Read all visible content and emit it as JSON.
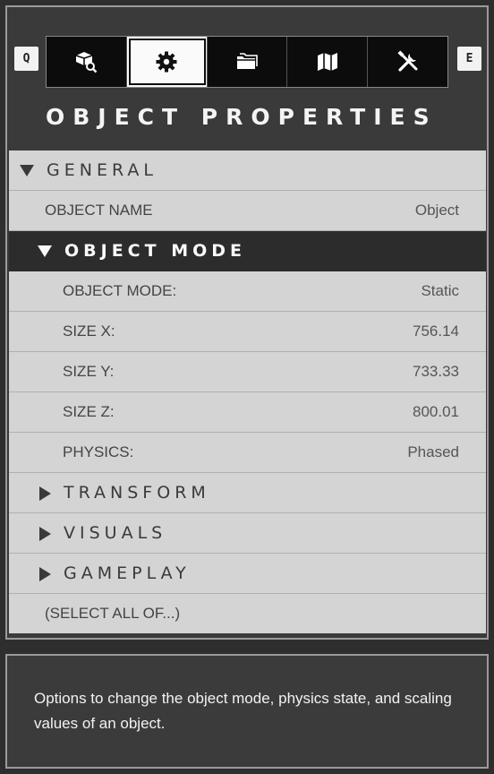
{
  "window": {
    "panel_title": "OBJECT PROPERTIES",
    "prev_key": "Q",
    "next_key": "E"
  },
  "tabs": [
    {
      "icon": "object-browser-icon",
      "active": false
    },
    {
      "icon": "gear-icon",
      "active": true
    },
    {
      "icon": "folder-icon",
      "active": false
    },
    {
      "icon": "map-icon",
      "active": false
    },
    {
      "icon": "tools-icon",
      "active": false
    }
  ],
  "properties": {
    "general_label": "GENERAL",
    "object_name_label": "OBJECT NAME",
    "object_name_value": "Object",
    "object_mode_section_label": "OBJECT MODE",
    "object_mode_label": "OBJECT MODE:",
    "object_mode_value": "Static",
    "size_x_label": "SIZE X:",
    "size_x_value": "756.14",
    "size_y_label": "SIZE Y:",
    "size_y_value": "733.33",
    "size_z_label": "SIZE Z:",
    "size_z_value": "800.01",
    "physics_label": "PHYSICS:",
    "physics_value": "Phased",
    "transform_label": "TRANSFORM",
    "visuals_label": "VISUALS",
    "gameplay_label": "GAMEPLAY",
    "select_all_label": "(SELECT ALL OF...)"
  },
  "description": {
    "text": "Options to change the object mode, physics state, and scaling values of an object."
  },
  "colors": {
    "background": "#2e2e2e",
    "row_background": "#d4d4d4",
    "selected_row": "#2c2c2c",
    "active_tab": "#fafafa"
  }
}
